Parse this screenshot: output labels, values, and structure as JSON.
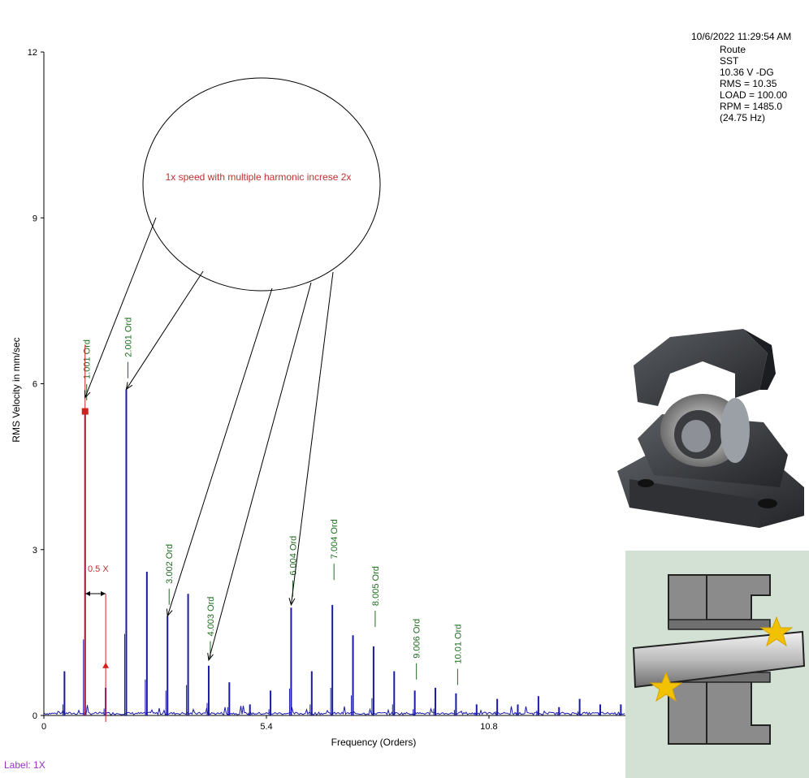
{
  "header": {
    "timestamp": "10/6/2022 11:29:54 AM",
    "lines": [
      "Route",
      "SST",
      "10.36 V -DG",
      "RMS = 10.35",
      "LOAD = 100.00",
      "RPM = 1485.0",
      "(24.75 Hz)"
    ]
  },
  "footer_label": "Label: 1X",
  "annotation": {
    "text": "1x speed with multiple harmonic increse 2x",
    "half_x_label": "0.5 X"
  },
  "colors": {
    "spectrum": "#1a1aa8",
    "order_label": "#1f6b1f",
    "marker": "#d42020",
    "annotation_text": "#c03030"
  },
  "chart_data": {
    "type": "line",
    "xlabel": "Frequency (Orders)",
    "ylabel": "RMS Velocity in mm/sec",
    "xlim": [
      0,
      14.1
    ],
    "ylim": [
      0,
      12
    ],
    "xticks": [
      0,
      5.4,
      10.8
    ],
    "xtick_labels": [
      "0",
      "5.4",
      "10.8"
    ],
    "yticks": [
      0,
      3,
      6,
      9,
      12
    ],
    "ytick_labels": [
      "0",
      "3",
      "6",
      "9",
      "12"
    ],
    "series": [
      {
        "peaks": [
          {
            "x": 0.5,
            "y": 0.8
          },
          {
            "x": 1.0,
            "y": 5.5
          },
          {
            "x": 1.5,
            "y": 0.5
          },
          {
            "x": 2.0,
            "y": 5.9
          },
          {
            "x": 2.5,
            "y": 2.6
          },
          {
            "x": 3.0,
            "y": 1.8
          },
          {
            "x": 3.5,
            "y": 2.2
          },
          {
            "x": 4.0,
            "y": 0.9
          },
          {
            "x": 4.5,
            "y": 0.6
          },
          {
            "x": 5.0,
            "y": 0.2
          },
          {
            "x": 5.5,
            "y": 0.45
          },
          {
            "x": 6.0,
            "y": 1.95
          },
          {
            "x": 6.5,
            "y": 0.8
          },
          {
            "x": 7.0,
            "y": 2.0
          },
          {
            "x": 7.5,
            "y": 1.45
          },
          {
            "x": 8.0,
            "y": 1.25
          },
          {
            "x": 8.5,
            "y": 0.8
          },
          {
            "x": 9.0,
            "y": 0.45
          },
          {
            "x": 9.5,
            "y": 0.5
          },
          {
            "x": 10.0,
            "y": 0.4
          },
          {
            "x": 10.5,
            "y": 0.2
          },
          {
            "x": 11.0,
            "y": 0.3
          },
          {
            "x": 11.5,
            "y": 0.2
          },
          {
            "x": 12.0,
            "y": 0.35
          },
          {
            "x": 12.5,
            "y": 0.15
          },
          {
            "x": 13.0,
            "y": 0.3
          },
          {
            "x": 13.5,
            "y": 0.2
          },
          {
            "x": 14.0,
            "y": 0.2
          }
        ]
      }
    ],
    "order_labels": [
      {
        "x": 1.0,
        "y": 5.7,
        "text": "1.001 Ord"
      },
      {
        "x": 2.0,
        "y": 6.1,
        "text": "2.001 Ord"
      },
      {
        "x": 3.0,
        "y": 2.0,
        "text": "3.002 Ord"
      },
      {
        "x": 4.0,
        "y": 1.05,
        "text": "4.003 Ord"
      },
      {
        "x": 6.0,
        "y": 2.15,
        "text": "6.004 Ord"
      },
      {
        "x": 7.0,
        "y": 2.45,
        "text": "7.004 Ord"
      },
      {
        "x": 8.0,
        "y": 1.6,
        "text": "8.005 Ord"
      },
      {
        "x": 9.0,
        "y": 0.65,
        "text": "9.006 Ord"
      },
      {
        "x": 10.0,
        "y": 0.55,
        "text": "10.01 Ord"
      }
    ],
    "markers": [
      {
        "x": 1.0,
        "y": 5.5
      },
      {
        "x": 1.5,
        "y": 0.9
      }
    ]
  }
}
